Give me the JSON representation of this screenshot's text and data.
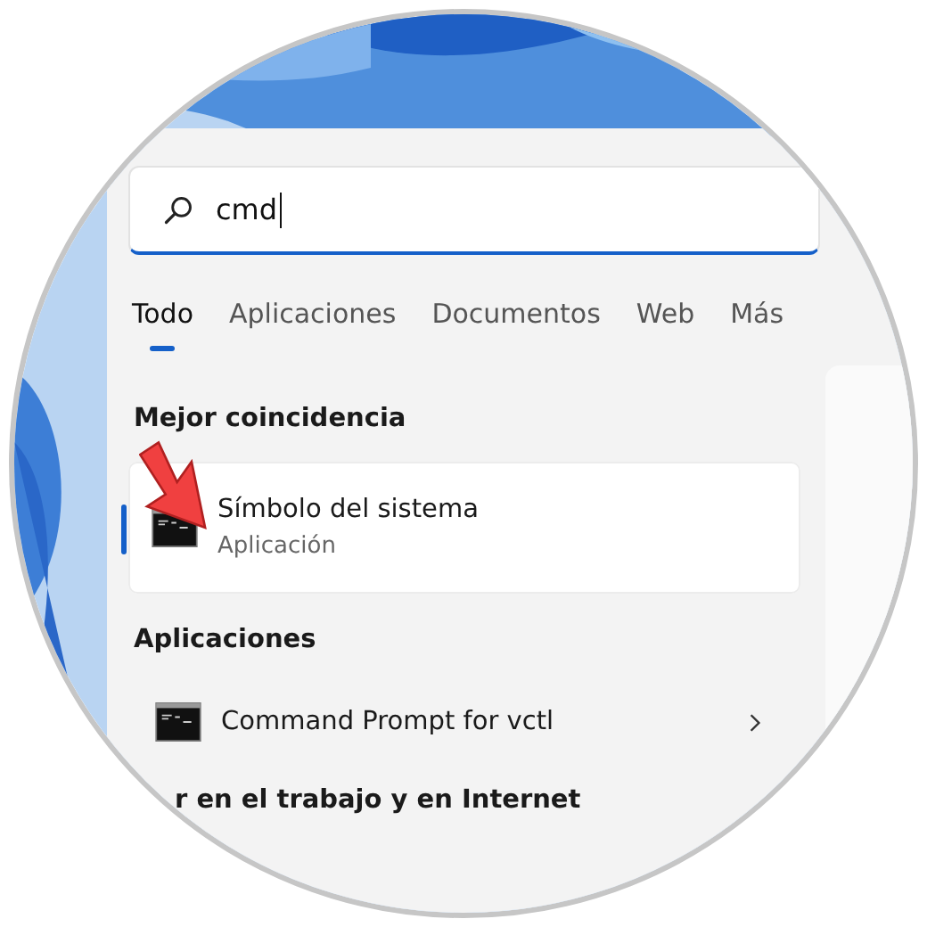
{
  "search": {
    "value": "cmd"
  },
  "tabs": [
    {
      "label": "Todo",
      "selected": true
    },
    {
      "label": "Aplicaciones",
      "selected": false
    },
    {
      "label": "Documentos",
      "selected": false
    },
    {
      "label": "Web",
      "selected": false
    },
    {
      "label": "Más",
      "selected": false
    }
  ],
  "sections": [
    {
      "heading": "Mejor coincidencia",
      "items": [
        {
          "kind": "best",
          "title": "Símbolo del sistema",
          "subtitle": "Aplicación",
          "selected": true
        }
      ]
    },
    {
      "heading": "Aplicaciones",
      "items": [
        {
          "kind": "app",
          "title": "Command Prompt for vctl",
          "selected": false
        }
      ]
    },
    {
      "heading": "r en el trabajo y en Internet"
    }
  ]
}
